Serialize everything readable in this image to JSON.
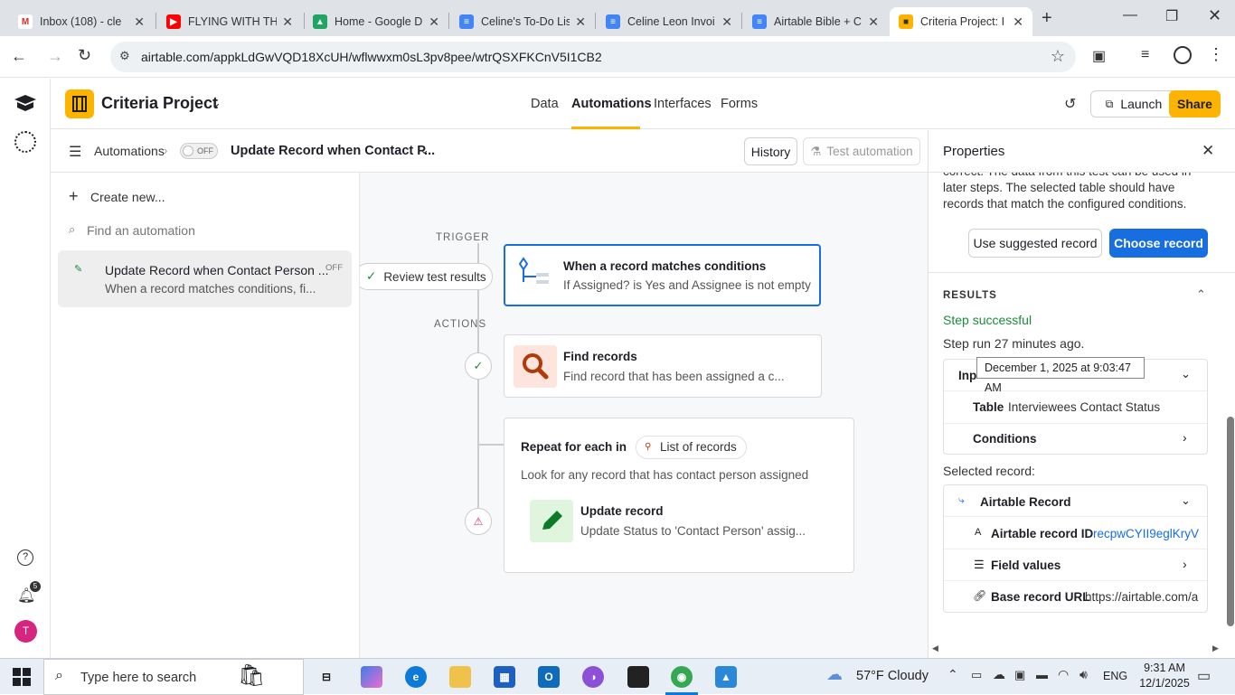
{
  "browser": {
    "tabs": [
      {
        "title": "Inbox (108) - cle",
        "fav": "M",
        "color": "#d93025"
      },
      {
        "title": "FLYING WITH THE",
        "fav": "▶",
        "color": "#ff0000"
      },
      {
        "title": "Home - Google D",
        "fav": "▲",
        "color": "#1fa463"
      },
      {
        "title": "Celine's To-Do Lis",
        "fav": "≡",
        "color": "#4285f4"
      },
      {
        "title": "Celine Leon Invoi",
        "fav": "≡",
        "color": "#4285f4"
      },
      {
        "title": "Airtable Bible + C",
        "fav": "≡",
        "color": "#4285f4"
      },
      {
        "title": "Criteria Project: I",
        "fav": "■",
        "color": "#fcb400"
      }
    ],
    "url": "airtable.com/appkLdGwVQD18XcUH/wflwwxm0sL3pv8pee/wtrQSXFKCnV5I1CB2"
  },
  "app": {
    "base_name": "Criteria Project",
    "nav": [
      "Data",
      "Automations",
      "Interfaces",
      "Forms"
    ],
    "launch_label": "Launch",
    "share_label": "Share",
    "brand_color": "#fcb400",
    "notif_count": "5",
    "avatar_letter": "T"
  },
  "subheader": {
    "section": "Automations",
    "toggle_label": "OFF",
    "automation_name": "Update Record when Contact P...",
    "history_label": "History",
    "test_label": "Test automation"
  },
  "sidebar": {
    "create_label": "Create new...",
    "search_placeholder": "Find an automation",
    "items": [
      {
        "title": "Update Record when Contact Person ...",
        "subtitle": "When a record matches conditions, fi...",
        "status": "OFF"
      }
    ]
  },
  "canvas": {
    "trigger_label": "TRIGGER",
    "actions_label": "ACTIONS",
    "review_label": "Review test results",
    "trigger_card": {
      "title": "When a record matches conditions",
      "desc": "If Assigned? is Yes and Assignee is not empty"
    },
    "find_card": {
      "title": "Find records",
      "desc": "Find record that has been assigned a c..."
    },
    "repeat_card": {
      "prefix": "Repeat for each in",
      "chip": "List of records",
      "desc": "Look for any record that has contact person assigned"
    },
    "update_card": {
      "title": "Update record",
      "desc": "Update Status to 'Contact Person' assig..."
    }
  },
  "properties": {
    "title": "Properties",
    "intro_text": "correct. The data from this test can be used in later steps. The selected table should have records that match the configured conditions.",
    "use_suggested_label": "Use suggested record",
    "choose_record_label": "Choose record",
    "results_label": "RESULTS",
    "step_status": "Step successful",
    "step_run": "Step run 27 minutes ago.",
    "tooltip": "December 1, 2025 at 9:03:47 AM",
    "input_label": "Inp",
    "table_label": "Table",
    "table_value": "Interviewees Contact Status",
    "conditions_label": "Conditions",
    "selected_record_label": "Selected record:",
    "airtable_record_label": "Airtable Record",
    "record_id_label": "Airtable record ID",
    "record_id_value": "recpwCYII9eglKryV",
    "field_values_label": "Field values",
    "base_url_label": "Base record URL",
    "base_url_value": "https://airtable.com/a"
  },
  "taskbar": {
    "search_placeholder": "Type here to search",
    "weather": "57°F  Cloudy",
    "lang": "ENG",
    "time": "9:31 AM",
    "date": "12/1/2025"
  }
}
